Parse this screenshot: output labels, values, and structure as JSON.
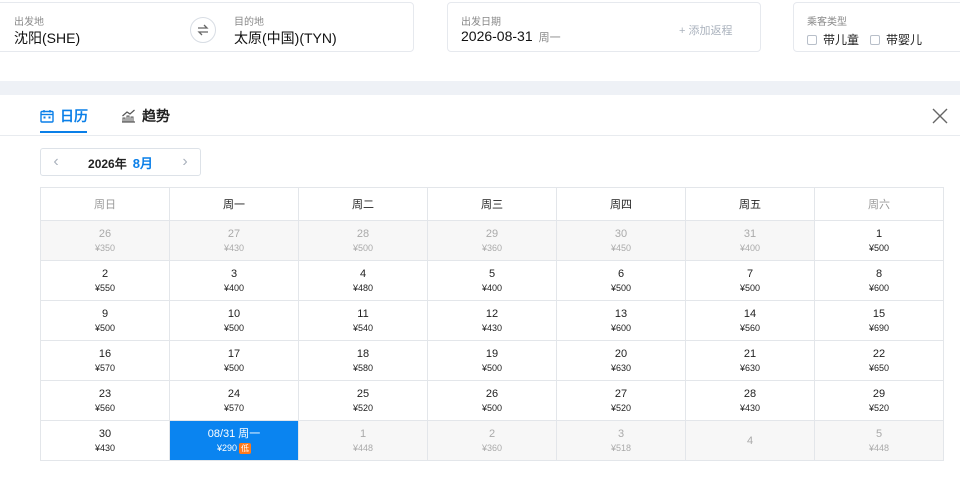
{
  "search": {
    "origin_label": "出发地",
    "origin_value": "沈阳(SHE)",
    "destination_label": "目的地",
    "destination_value": "太原(中国)(TYN)",
    "date_label": "出发日期",
    "date_value": "2026-08-31",
    "date_weekday": "周一",
    "add_return": "+ 添加返程",
    "pax_label": "乘客类型",
    "child_label": "带儿童",
    "infant_label": "带婴儿"
  },
  "tabs": {
    "calendar": "日历",
    "trend": "趋势"
  },
  "month_nav": {
    "year": "2026年",
    "month": "8月"
  },
  "weekdays": [
    "周日",
    "周一",
    "周二",
    "周三",
    "周四",
    "周五",
    "周六"
  ],
  "weeks": [
    [
      {
        "day": "26",
        "price": "¥350",
        "state": "other"
      },
      {
        "day": "27",
        "price": "¥430",
        "state": "other"
      },
      {
        "day": "28",
        "price": "¥500",
        "state": "other"
      },
      {
        "day": "29",
        "price": "¥360",
        "state": "other"
      },
      {
        "day": "30",
        "price": "¥450",
        "state": "other"
      },
      {
        "day": "31",
        "price": "¥400",
        "state": "other"
      },
      {
        "day": "1",
        "price": "¥500",
        "state": "normal"
      }
    ],
    [
      {
        "day": "2",
        "price": "¥550",
        "state": "normal"
      },
      {
        "day": "3",
        "price": "¥400",
        "state": "normal"
      },
      {
        "day": "4",
        "price": "¥480",
        "state": "normal"
      },
      {
        "day": "5",
        "price": "¥400",
        "state": "normal"
      },
      {
        "day": "6",
        "price": "¥500",
        "state": "normal"
      },
      {
        "day": "7",
        "price": "¥500",
        "state": "normal"
      },
      {
        "day": "8",
        "price": "¥600",
        "state": "normal"
      }
    ],
    [
      {
        "day": "9",
        "price": "¥500",
        "state": "normal"
      },
      {
        "day": "10",
        "price": "¥500",
        "state": "normal"
      },
      {
        "day": "11",
        "price": "¥540",
        "state": "normal"
      },
      {
        "day": "12",
        "price": "¥430",
        "state": "normal"
      },
      {
        "day": "13",
        "price": "¥600",
        "state": "normal"
      },
      {
        "day": "14",
        "price": "¥560",
        "state": "normal"
      },
      {
        "day": "15",
        "price": "¥690",
        "state": "normal"
      }
    ],
    [
      {
        "day": "16",
        "price": "¥570",
        "state": "normal"
      },
      {
        "day": "17",
        "price": "¥500",
        "state": "normal"
      },
      {
        "day": "18",
        "price": "¥580",
        "state": "normal"
      },
      {
        "day": "19",
        "price": "¥500",
        "state": "normal"
      },
      {
        "day": "20",
        "price": "¥630",
        "state": "normal"
      },
      {
        "day": "21",
        "price": "¥630",
        "state": "normal"
      },
      {
        "day": "22",
        "price": "¥650",
        "state": "normal"
      }
    ],
    [
      {
        "day": "23",
        "price": "¥560",
        "state": "normal"
      },
      {
        "day": "24",
        "price": "¥570",
        "state": "normal"
      },
      {
        "day": "25",
        "price": "¥520",
        "state": "normal"
      },
      {
        "day": "26",
        "price": "¥500",
        "state": "normal"
      },
      {
        "day": "27",
        "price": "¥520",
        "state": "normal"
      },
      {
        "day": "28",
        "price": "¥430",
        "state": "normal"
      },
      {
        "day": "29",
        "price": "¥520",
        "state": "normal"
      }
    ],
    [
      {
        "day": "30",
        "price": "¥430",
        "state": "normal"
      },
      {
        "day": "08/31 周一",
        "price": "¥290",
        "state": "selected",
        "badge": "低"
      },
      {
        "day": "1",
        "price": "¥448",
        "state": "future"
      },
      {
        "day": "2",
        "price": "¥360",
        "state": "future"
      },
      {
        "day": "3",
        "price": "¥518",
        "state": "future"
      },
      {
        "day": "4",
        "price": "",
        "state": "future"
      },
      {
        "day": "5",
        "price": "¥448",
        "state": "future"
      }
    ]
  ],
  "colors": {
    "accent": "#0a7fe8",
    "selected_bg": "#0a84f0",
    "low_badge": "#ff7a1a"
  }
}
